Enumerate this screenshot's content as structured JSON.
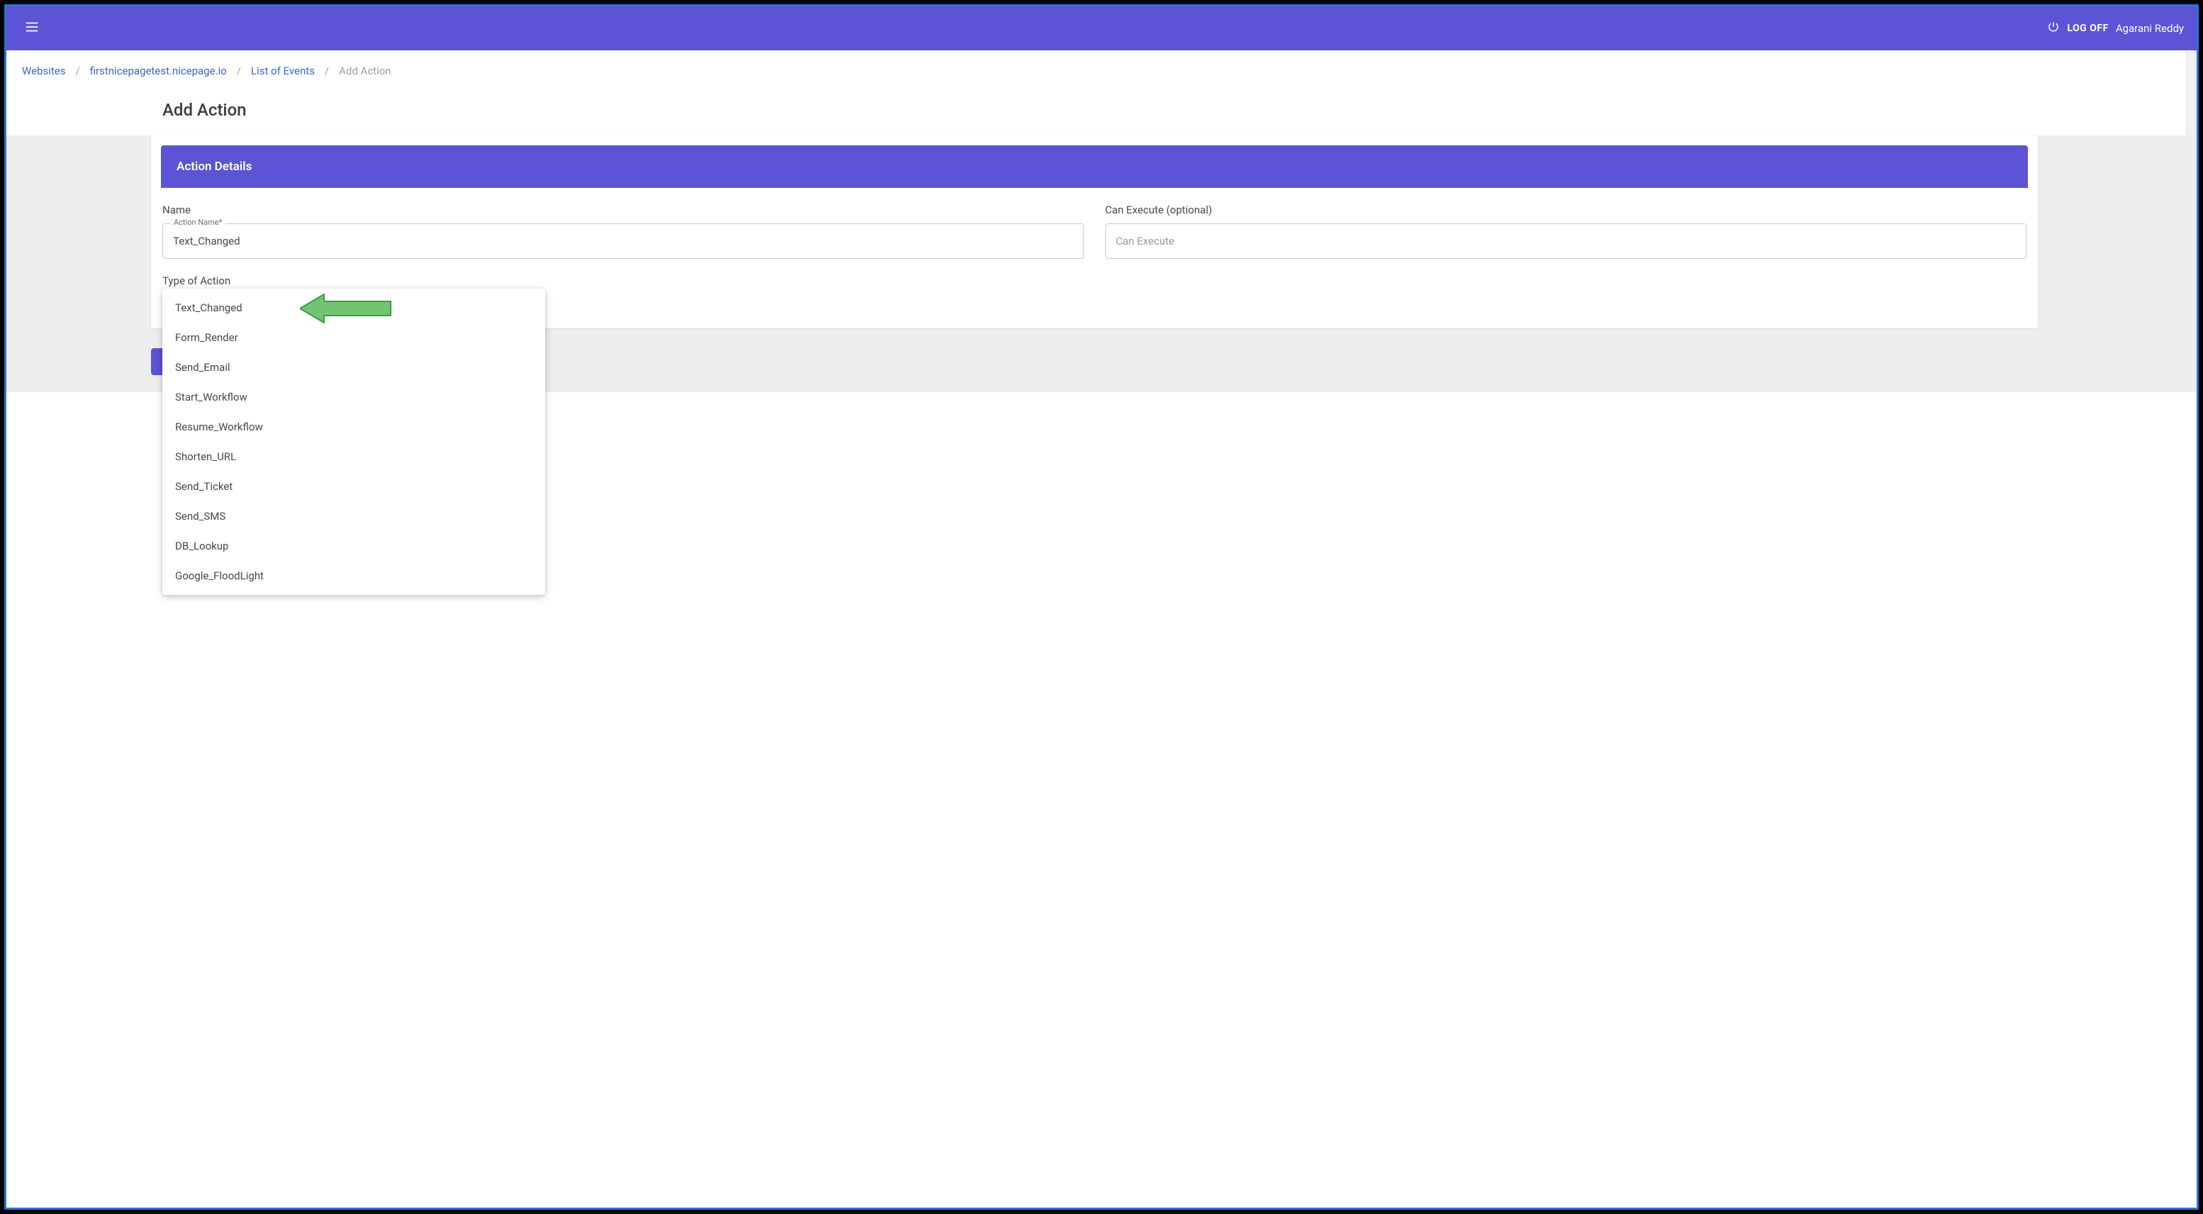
{
  "colors": {
    "brand": "#5c53d7",
    "link": "#3a66d1",
    "arrow_fill": "#72c472",
    "arrow_stroke": "#3f9a3f"
  },
  "appbar": {
    "logoff_label": "LOG OFF",
    "username": "Agarani Reddy"
  },
  "breadcrumb": {
    "items": [
      {
        "label": "Websites",
        "link": true
      },
      {
        "label": "firstnicepagetest.nicepage.io",
        "link": true
      },
      {
        "label": "List of Events",
        "link": true
      }
    ],
    "current": "Add Action"
  },
  "page": {
    "title": "Add Action"
  },
  "card": {
    "header": "Action Details",
    "name_label": "Name",
    "name_float_label": "Action Name*",
    "name_value": "Text_Changed",
    "can_execute_label": "Can Execute (optional)",
    "can_execute_placeholder": "Can Execute",
    "type_label": "Type of Action"
  },
  "dropdown": {
    "options": [
      "Text_Changed",
      "Form_Render",
      "Send_Email",
      "Start_Workflow",
      "Resume_Workflow",
      "Shorten_URL",
      "Send_Ticket",
      "Send_SMS",
      "DB_Lookup",
      "Google_FloodLight"
    ]
  }
}
